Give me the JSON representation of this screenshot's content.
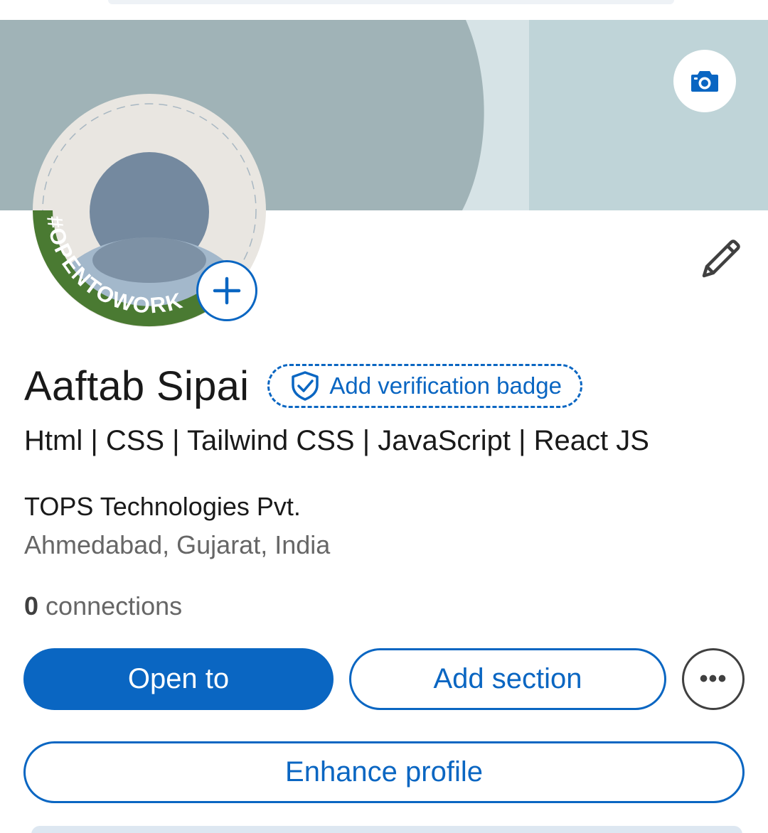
{
  "profile": {
    "name": "Aaftab Sipai",
    "verification_badge_label": "Add verification badge",
    "headline": "Html | CSS | Tailwind CSS | JavaScript | React JS",
    "company": "TOPS Technologies Pvt.",
    "location": "Ahmedabad, Gujarat, India",
    "connections_count": "0",
    "connections_label": "connections",
    "open_to_work_frame": "#OPENTOWORK"
  },
  "actions": {
    "open_to_label": "Open to",
    "add_section_label": "Add section",
    "more_label": "•••",
    "enhance_profile_label": "Enhance profile"
  },
  "icons": {
    "cover_camera": "camera-icon",
    "add_photo": "plus-icon",
    "edit_intro": "pencil-icon",
    "verification": "shield-check-icon",
    "more": "ellipsis-icon"
  },
  "colors": {
    "brand_blue": "#0a66c2",
    "open_to_work_green": "#4a7a32",
    "text_primary": "#191919",
    "text_secondary": "#666666",
    "cover_dark": "#a0b3b7",
    "cover_light": "#bfd4d8"
  }
}
